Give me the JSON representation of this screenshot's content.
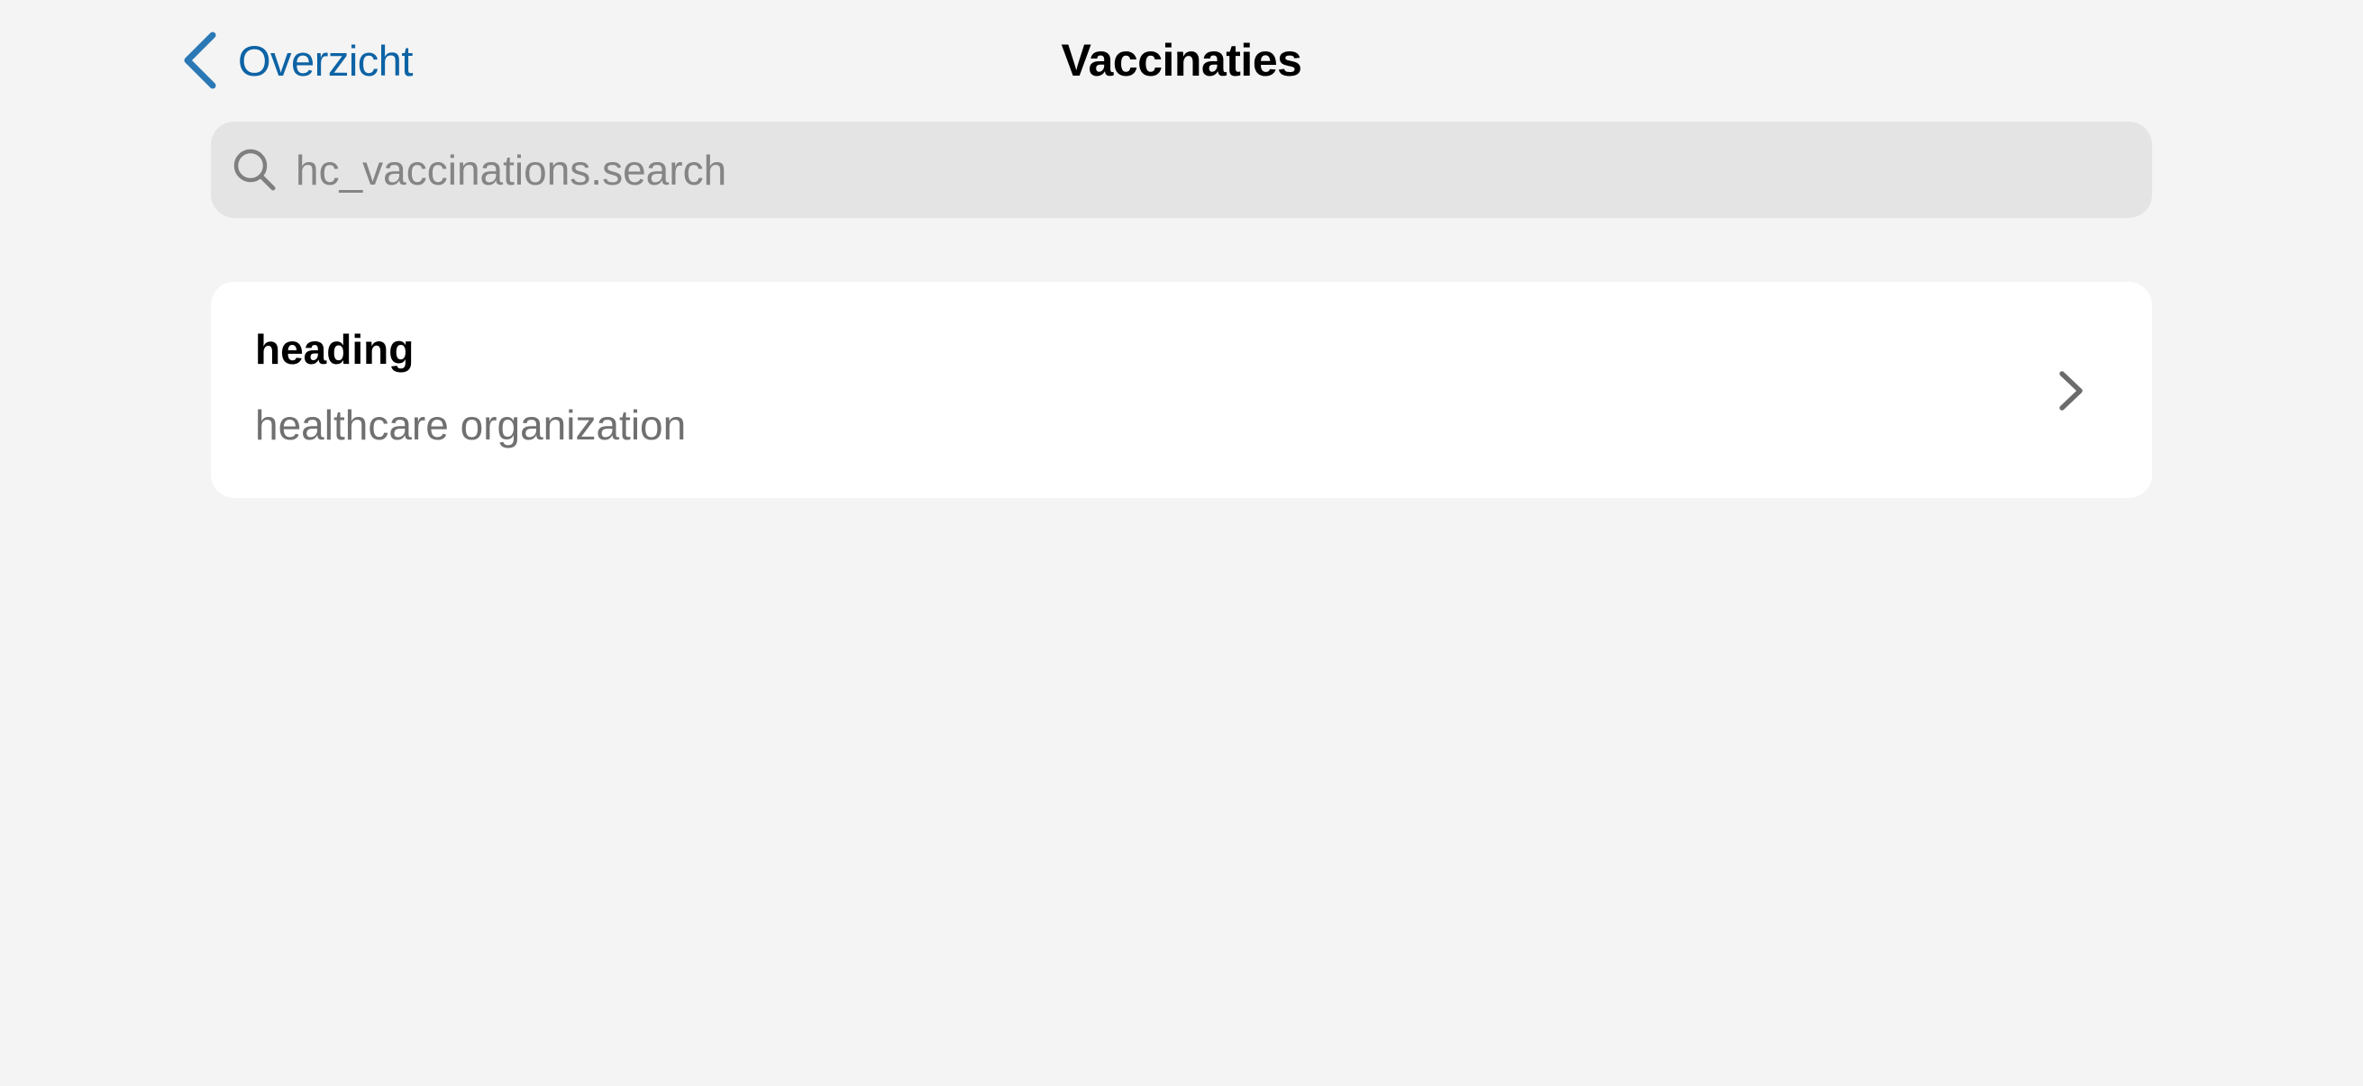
{
  "nav": {
    "back_label": "Overzicht",
    "title": "Vaccinaties"
  },
  "search": {
    "placeholder": "hc_vaccinations.search",
    "value": ""
  },
  "list": [
    {
      "heading": "heading",
      "subtitle": "healthcare organization"
    }
  ],
  "colors": {
    "accent": "#0d63a5",
    "background": "#f4f4f4",
    "search_bg": "#e4e4e4"
  }
}
